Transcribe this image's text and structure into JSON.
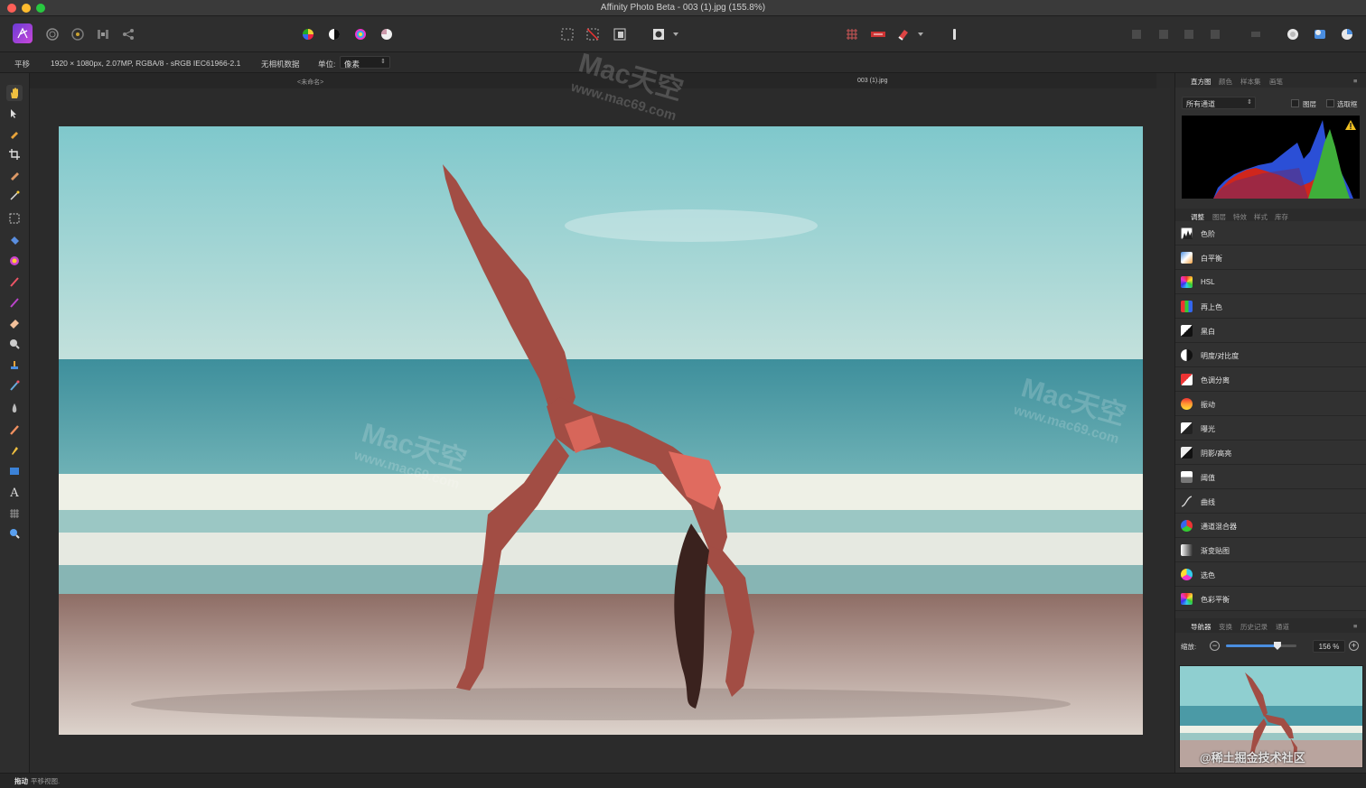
{
  "window": {
    "title": "Affinity Photo Beta - 003 (1).jpg (155.8%)"
  },
  "context": {
    "tool_name": "平移",
    "doc_info": "1920 × 1080px, 2.07MP, RGBA/8 - sRGB IEC61966-2.1",
    "camera": "无相机数据",
    "unit_label": "单位:",
    "unit_value": "像素"
  },
  "doc_tabs": {
    "untitled": "<未命名>",
    "file": "003 (1).jpg"
  },
  "histogram_panel": {
    "tabs": [
      "直方图",
      "颜色",
      "样本集",
      "画笔"
    ],
    "channel": "所有通道",
    "layer_check": "图层",
    "marquee_check": "选取框"
  },
  "adjust_panel": {
    "tabs": [
      "调整",
      "图层",
      "特效",
      "样式",
      "库存"
    ],
    "items": [
      {
        "label": "色阶",
        "icon": "levels-icon"
      },
      {
        "label": "白平衡",
        "icon": "white-balance-icon"
      },
      {
        "label": "HSL",
        "icon": "hsl-icon"
      },
      {
        "label": "再上色",
        "icon": "recolor-icon"
      },
      {
        "label": "黑白",
        "icon": "black-white-icon"
      },
      {
        "label": "明度/对比度",
        "icon": "brightness-contrast-icon"
      },
      {
        "label": "色调分离",
        "icon": "posterize-icon"
      },
      {
        "label": "振动",
        "icon": "vibrance-icon"
      },
      {
        "label": "曝光",
        "icon": "exposure-icon"
      },
      {
        "label": "阴影/高亮",
        "icon": "shadows-highlights-icon"
      },
      {
        "label": "阈值",
        "icon": "threshold-icon"
      },
      {
        "label": "曲线",
        "icon": "curves-icon"
      },
      {
        "label": "通道混合器",
        "icon": "channel-mixer-icon"
      },
      {
        "label": "渐变贴图",
        "icon": "gradient-map-icon"
      },
      {
        "label": "选色",
        "icon": "selective-color-icon"
      },
      {
        "label": "色彩平衡",
        "icon": "color-balance-icon"
      }
    ]
  },
  "navigator_panel": {
    "tabs": [
      "导航器",
      "变换",
      "历史记录",
      "通道"
    ],
    "zoom_label": "缩放:",
    "zoom_value": "156 %",
    "zoom_fraction": 0.73
  },
  "status": {
    "bold": "拖动",
    "rest": "平移视图."
  },
  "watermarks": {
    "brand": "Mac天空",
    "url": "www.mac69.com",
    "credit": "@稀土掘金技术社区"
  },
  "colors": {
    "accent": "#4a8ee0",
    "histogram_blue": "#2b4fd6",
    "histogram_red": "#d0261c",
    "histogram_green": "#3fae3a"
  }
}
